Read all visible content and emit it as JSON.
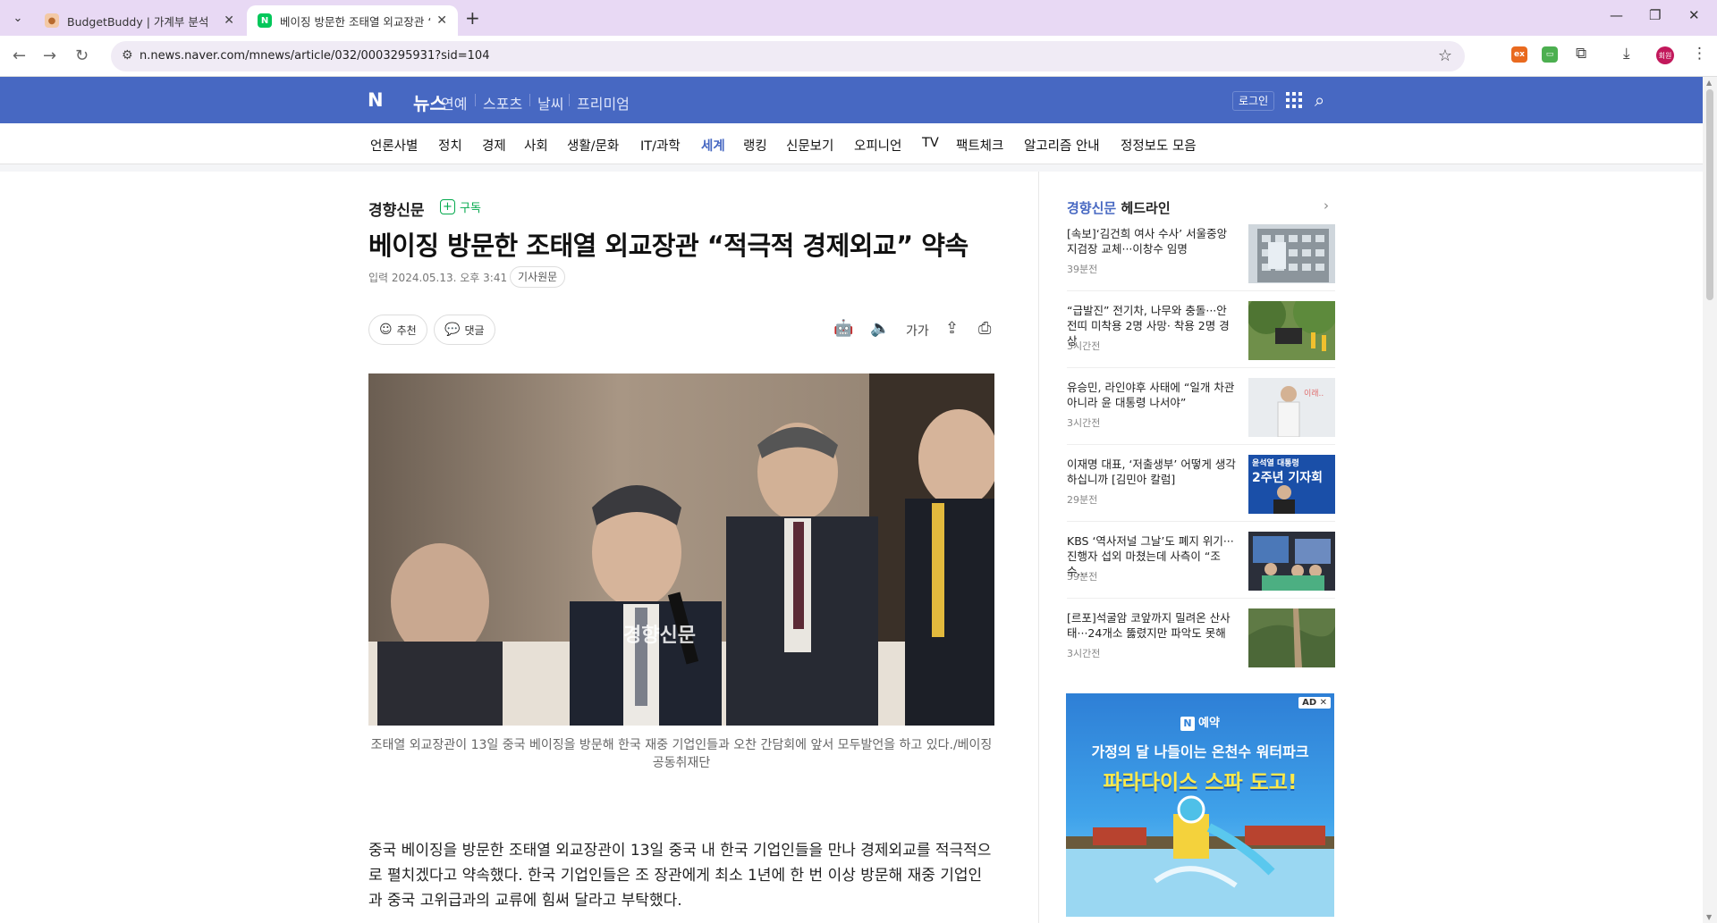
{
  "browser": {
    "tabs": [
      {
        "title": "BudgetBuddy | 가계부 분석",
        "favicon": "budgetbuddy-favicon"
      },
      {
        "title": "베이징 방문한 조태열 외교장관 “적극적 경제외교” 약속",
        "favicon": "naver-favicon"
      }
    ],
    "url": "n.news.naver.com/mnews/article/032/0003295931?sid=104",
    "profile_label": "회원",
    "theme_color": "#e8d9f4"
  },
  "naver": {
    "logo": "N",
    "section": "뉴스",
    "sub_links": [
      "연예",
      "스포츠",
      "날씨",
      "프리미엄"
    ],
    "login": "로그인",
    "brand_color": "#4768c2",
    "categories": [
      "언론사별",
      "정치",
      "경제",
      "사회",
      "생활/문화",
      "IT/과학",
      "세계",
      "랭킹",
      "신문보기",
      "오피니언",
      "TV",
      "팩트체크",
      "알고리즘 안내",
      "정정보도 모음"
    ],
    "active_category": "세계"
  },
  "article": {
    "press": "경향신문",
    "subscribe": "구독",
    "headline": "베이징 방문한 조태열 외교장관 “적극적 경제외교” 약속",
    "date_label": "입력",
    "date": "2024.05.13. 오후 3:41",
    "original_link": "기사원문",
    "recommend": "추천",
    "comments": "댓글",
    "photo_watermark": "경향신문",
    "caption": "조태열 외교장관이 13일 중국 베이징을 방문해 한국 재중 기업인들과 오찬 간담회에 앞서 모두발언을 하고 있다./베이징 공동취재단",
    "body": "중국 베이징을 방문한 조태열 외교장관이 13일 중국 내 한국 기업인들을 만나 경제외교를 적극적으로 펼치겠다고 약속했다. 한국 기업인들은 조 장관에게 최소 1년에 한 번 이상 방문해 재중 기업인과 중국 고위급과의 교류에 힘써 달라고 부탁했다."
  },
  "sidebar": {
    "press": "경향신문",
    "title": "헤드라인",
    "items": [
      {
        "text": "[속보]‘김건희 여사 수사’ 서울중앙지검장 교체···이창수 임명",
        "time": "39분전"
      },
      {
        "text": "“급발진” 전기차, 나무와 충돌···안전띠 미착용 2명 사망· 착용 2명 경상",
        "time": "3시간전"
      },
      {
        "text": "유승민, 라인야후 사태에 “일개 차관 아니라 윤 대통령 나서야”",
        "time": "3시간전"
      },
      {
        "text": "이재명 대표, ‘저출생부’ 어떻게 생각하십니까 [김민아 칼럼]",
        "time": "29분전"
      },
      {
        "text": "KBS ‘역사저널 그날’도 폐지 위기···진행자 섭외 마쳤는데 사측이 “조수...",
        "time": "59분전"
      },
      {
        "text": "[르포]석굴암 코앞까지 밀려온 산사태···24개소 뚫렸지만 파악도 못해",
        "time": "3시간전"
      }
    ],
    "ad": {
      "badge": "AD ✕",
      "brand": "예약",
      "line1": "가정의 달 나들이는 온천수 워터파크",
      "line2": "파라다이스 스파 도고!"
    }
  }
}
